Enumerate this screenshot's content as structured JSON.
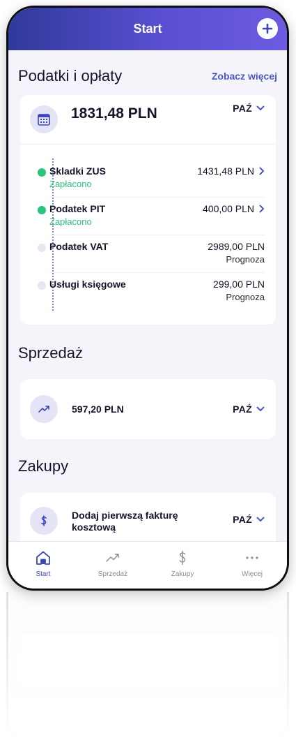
{
  "header": {
    "title": "Start"
  },
  "taxes": {
    "section_title": "Podatki i opłaty",
    "see_more": "Zobacz więcej",
    "total": "1831,48 PLN",
    "month": "PAŹ",
    "items": [
      {
        "name": "Skladki ZUS",
        "status": "Zapłacono",
        "amount": "1431,48 PLN",
        "paid": true
      },
      {
        "name": "Podatek PIT",
        "status": "Zapłacono",
        "amount": "400,00 PLN",
        "paid": true
      },
      {
        "name": "Podatek VAT",
        "status": "Prognoza",
        "amount": "2989,00 PLN",
        "paid": false
      },
      {
        "name": "Usługi księgowe",
        "status": "Prognoza",
        "amount": "299,00 PLN",
        "paid": false
      }
    ]
  },
  "sales": {
    "section_title": "Sprzedaż",
    "amount": "597,20 PLN",
    "month": "PAŹ"
  },
  "purchases": {
    "section_title": "Zakupy",
    "text": "Dodaj pierwszą fakturę kosztową",
    "month": "PAŹ"
  },
  "tabs": [
    {
      "label": "Start",
      "icon": "home-icon",
      "active": true
    },
    {
      "label": "Sprzedaż",
      "icon": "trend-up-icon",
      "active": false
    },
    {
      "label": "Zakupy",
      "icon": "dollar-icon",
      "active": false
    },
    {
      "label": "Więcej",
      "icon": "more-icon",
      "active": false
    }
  ],
  "colors": {
    "accent": "#4b57c9",
    "paid": "#2cc37d",
    "header_start": "#2f3a9a",
    "header_end": "#6c5be0"
  }
}
